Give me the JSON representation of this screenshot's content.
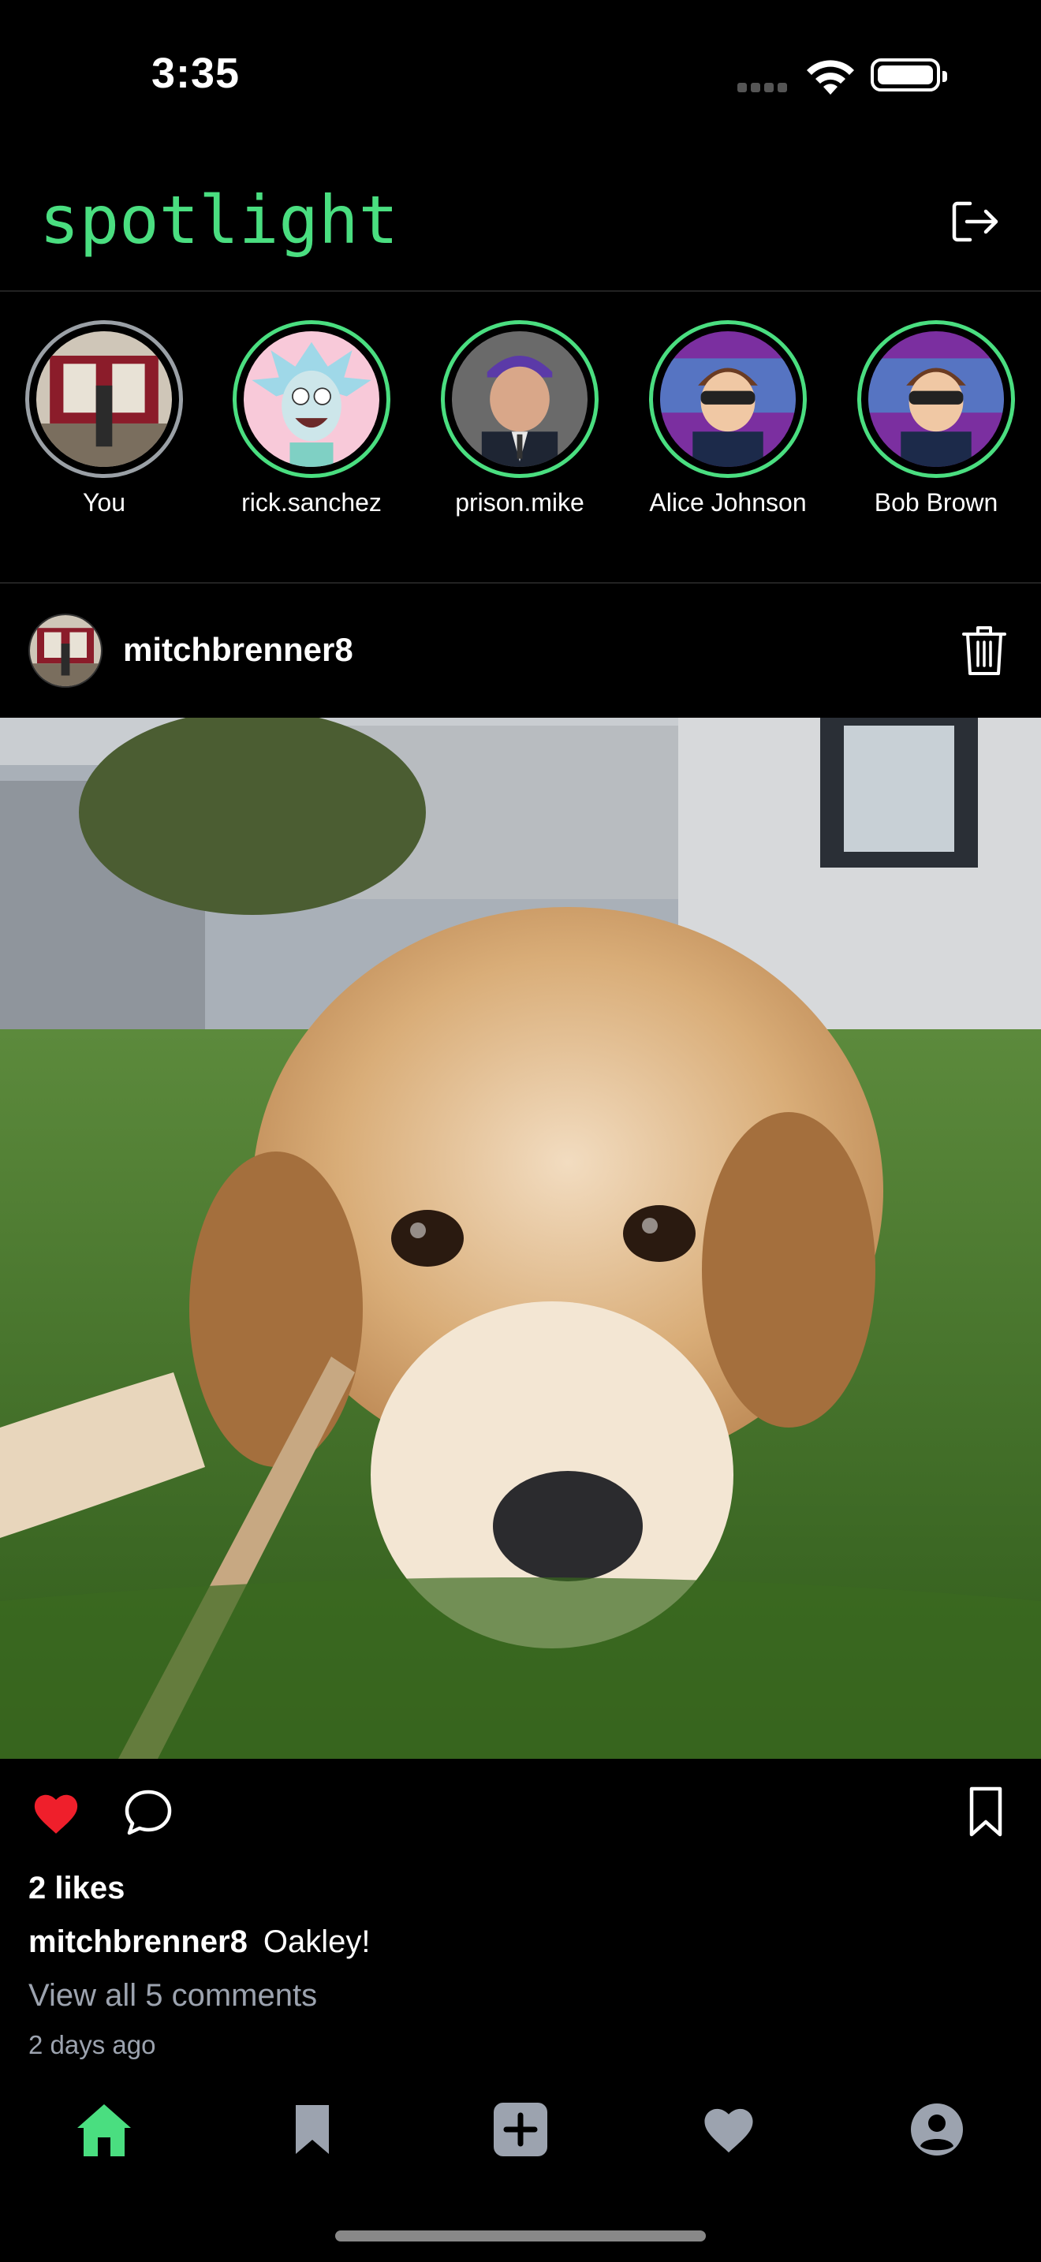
{
  "status_bar": {
    "time": "3:35"
  },
  "header": {
    "title": "spotlight",
    "logout_icon": "logout-icon"
  },
  "stories": [
    {
      "name": "You"
    },
    {
      "name": "rick.sanchez"
    },
    {
      "name": "prison.mike"
    },
    {
      "name": "Alice Johnson"
    },
    {
      "name": "Bob Brown"
    }
  ],
  "post": {
    "username": "mitchbrenner8",
    "likes": "2 likes",
    "caption_user": "mitchbrenner8",
    "caption_text": "Oakley!",
    "view_comments": "View all 5 comments",
    "time_ago": "2 days ago",
    "liked": true
  },
  "colors": {
    "accent": "#4ade80",
    "like": "#ef1f2b",
    "muted": "#9ca3af",
    "tab_inactive": "#9ca3af"
  },
  "tabs": [
    {
      "icon": "home-icon",
      "active": true
    },
    {
      "icon": "bookmark-icon",
      "active": false
    },
    {
      "icon": "add-post-icon",
      "active": false
    },
    {
      "icon": "heart-icon",
      "active": false
    },
    {
      "icon": "profile-icon",
      "active": false
    }
  ]
}
